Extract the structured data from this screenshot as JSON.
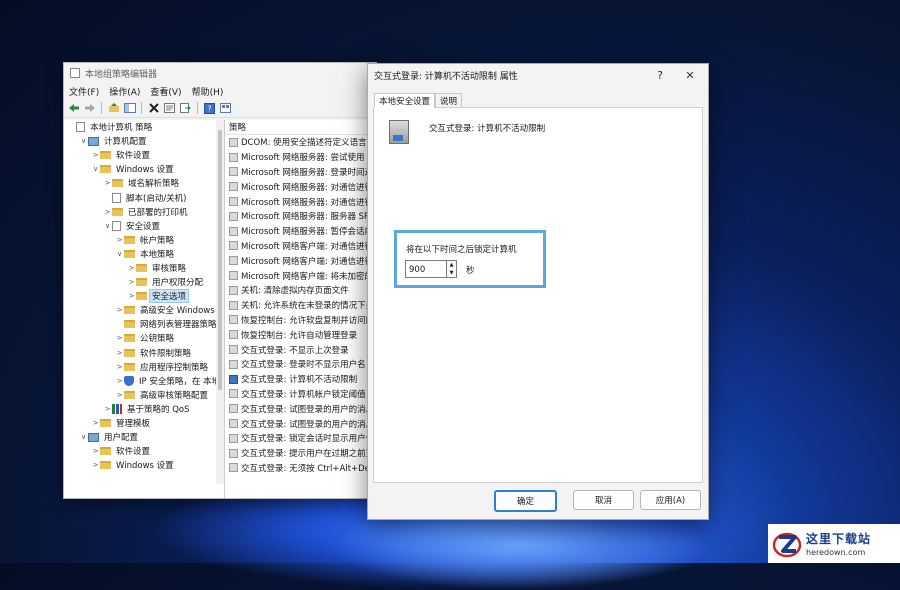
{
  "main_window": {
    "title": "本地组策略编辑器",
    "menu": [
      "文件(F)",
      "操作(A)",
      "查看(V)",
      "帮助(H)"
    ],
    "toolbar_icons": [
      "back-arrow-icon",
      "forward-arrow-icon",
      "up-folder-icon",
      "show-hide-tree-icon",
      "delete-icon",
      "properties-icon",
      "export-icon",
      "help-icon",
      "view-icon"
    ],
    "tree": [
      {
        "label": "本地计算机 策略",
        "depth": 0,
        "icon": "doc",
        "toggle": ""
      },
      {
        "label": "计算机配置",
        "depth": 1,
        "icon": "pc",
        "toggle": "∨"
      },
      {
        "label": "软件设置",
        "depth": 2,
        "icon": "folder",
        "toggle": ">"
      },
      {
        "label": "Windows 设置",
        "depth": 2,
        "icon": "folder",
        "toggle": "∨"
      },
      {
        "label": "域名解析策略",
        "depth": 3,
        "icon": "folder",
        "toggle": ">"
      },
      {
        "label": "脚本(启动/关机)",
        "depth": 3,
        "icon": "doc",
        "toggle": ""
      },
      {
        "label": "已部署的打印机",
        "depth": 3,
        "icon": "folder",
        "toggle": ">"
      },
      {
        "label": "安全设置",
        "depth": 3,
        "icon": "doc",
        "toggle": "∨"
      },
      {
        "label": "帐户策略",
        "depth": 4,
        "icon": "folder",
        "toggle": ">"
      },
      {
        "label": "本地策略",
        "depth": 4,
        "icon": "folder",
        "toggle": "∨"
      },
      {
        "label": "审核策略",
        "depth": 5,
        "icon": "folder",
        "toggle": ">"
      },
      {
        "label": "用户权限分配",
        "depth": 5,
        "icon": "folder",
        "toggle": ">"
      },
      {
        "label": "安全选项",
        "depth": 5,
        "icon": "folder",
        "toggle": ">",
        "selected": true
      },
      {
        "label": "高级安全 Windows",
        "depth": 4,
        "icon": "folder",
        "toggle": ">"
      },
      {
        "label": "网络列表管理器策略",
        "depth": 4,
        "icon": "folder",
        "toggle": ""
      },
      {
        "label": "公钥策略",
        "depth": 4,
        "icon": "folder",
        "toggle": ">"
      },
      {
        "label": "软件限制策略",
        "depth": 4,
        "icon": "folder",
        "toggle": ">"
      },
      {
        "label": "应用程序控制策略",
        "depth": 4,
        "icon": "folder",
        "toggle": ">"
      },
      {
        "label": "IP 安全策略，在 本地",
        "depth": 4,
        "icon": "shield",
        "toggle": ">"
      },
      {
        "label": "高级审核策略配置",
        "depth": 4,
        "icon": "folder",
        "toggle": ">"
      },
      {
        "label": "基于策略的 QoS",
        "depth": 3,
        "icon": "chart",
        "toggle": ">"
      },
      {
        "label": "管理模板",
        "depth": 2,
        "icon": "folder",
        "toggle": ">"
      },
      {
        "label": "用户配置",
        "depth": 1,
        "icon": "pc",
        "toggle": "∨"
      },
      {
        "label": "软件设置",
        "depth": 2,
        "icon": "folder",
        "toggle": ">"
      },
      {
        "label": "Windows 设置",
        "depth": 2,
        "icon": "folder",
        "toggle": ">"
      }
    ],
    "list_header": "策略",
    "policies": [
      {
        "label": "DCOM: 使用安全描述符定义语言"
      },
      {
        "label": "Microsoft 网络服务器: 尝试使用"
      },
      {
        "label": "Microsoft 网络服务器: 登录时间过"
      },
      {
        "label": "Microsoft 网络服务器: 对通信进行"
      },
      {
        "label": "Microsoft 网络服务器: 对通信进行"
      },
      {
        "label": "Microsoft 网络服务器: 服务器 SP"
      },
      {
        "label": "Microsoft 网络服务器: 暂停会话前"
      },
      {
        "label": "Microsoft 网络客户端: 对通信进行"
      },
      {
        "label": "Microsoft 网络客户端: 对通信进行"
      },
      {
        "label": "Microsoft 网络客户端: 将未加密的"
      },
      {
        "label": "关机: 清除虚拟内存页面文件"
      },
      {
        "label": "关机: 允许系统在未登录的情况下关"
      },
      {
        "label": "恢复控制台: 允许软盘复制并访问所"
      },
      {
        "label": "恢复控制台: 允许自动管理登录"
      },
      {
        "label": "交互式登录: 不显示上次登录"
      },
      {
        "label": "交互式登录: 登录时不显示用户名"
      },
      {
        "label": "交互式登录: 计算机不活动限制",
        "selected": true
      },
      {
        "label": "交互式登录: 计算机帐户锁定阈值"
      },
      {
        "label": "交互式登录: 试图登录的用户的消息"
      },
      {
        "label": "交互式登录: 试图登录的用户的消息"
      },
      {
        "label": "交互式登录: 锁定会话时显示用户信"
      },
      {
        "label": "交互式登录: 提示用户在过期之前更"
      },
      {
        "label": "交互式登录: 无须按 Ctrl+Alt+Del"
      }
    ]
  },
  "dialog": {
    "title": "交互式登录: 计算机不活动限制 属性",
    "help_glyph": "?",
    "close_glyph": "✕",
    "tabs": [
      "本地安全设置",
      "说明"
    ],
    "policy_name": "交互式登录: 计算机不活动限制",
    "lock_label": "将在以下时间之后锁定计算机",
    "value": "900",
    "unit": "秒",
    "buttons": {
      "ok": "确定",
      "cancel": "取消",
      "apply": "应用(A)"
    }
  },
  "watermark": {
    "cn": "这里下载站",
    "en": "heredown.com"
  }
}
